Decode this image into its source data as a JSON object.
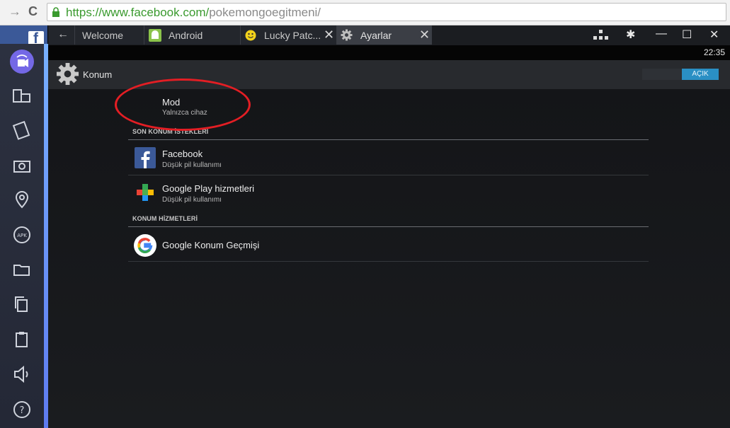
{
  "browser": {
    "url_host": "https://www.facebook.com/",
    "url_path": "pokemongoegitmeni/"
  },
  "tabs": [
    {
      "label": "Welcome"
    },
    {
      "label": "Android"
    },
    {
      "label": "Lucky Patc..."
    },
    {
      "label": "Ayarlar"
    }
  ],
  "status": {
    "time": "22:35"
  },
  "actionbar": {
    "title": "Konum",
    "toggle_label": "AÇIK"
  },
  "mode": {
    "title": "Mod",
    "subtitle": "Yalnızca cihaz"
  },
  "sections": {
    "recent": "SON KONUM İSTEKLERİ",
    "services": "KONUM HİZMETLERİ"
  },
  "recent_requests": [
    {
      "title": "Facebook",
      "subtitle": "Düşük pil kullanımı",
      "icon": "facebook-icon"
    },
    {
      "title": "Google Play hizmetleri",
      "subtitle": "Düşük pil kullanımı",
      "icon": "google-play-services-icon"
    }
  ],
  "services": [
    {
      "title": "Google Konum Geçmişi",
      "icon": "google-icon"
    }
  ],
  "colors": {
    "accent": "#2a8fc4",
    "annotation": "#e31e24",
    "sidebar_accent": "#7468e6"
  }
}
